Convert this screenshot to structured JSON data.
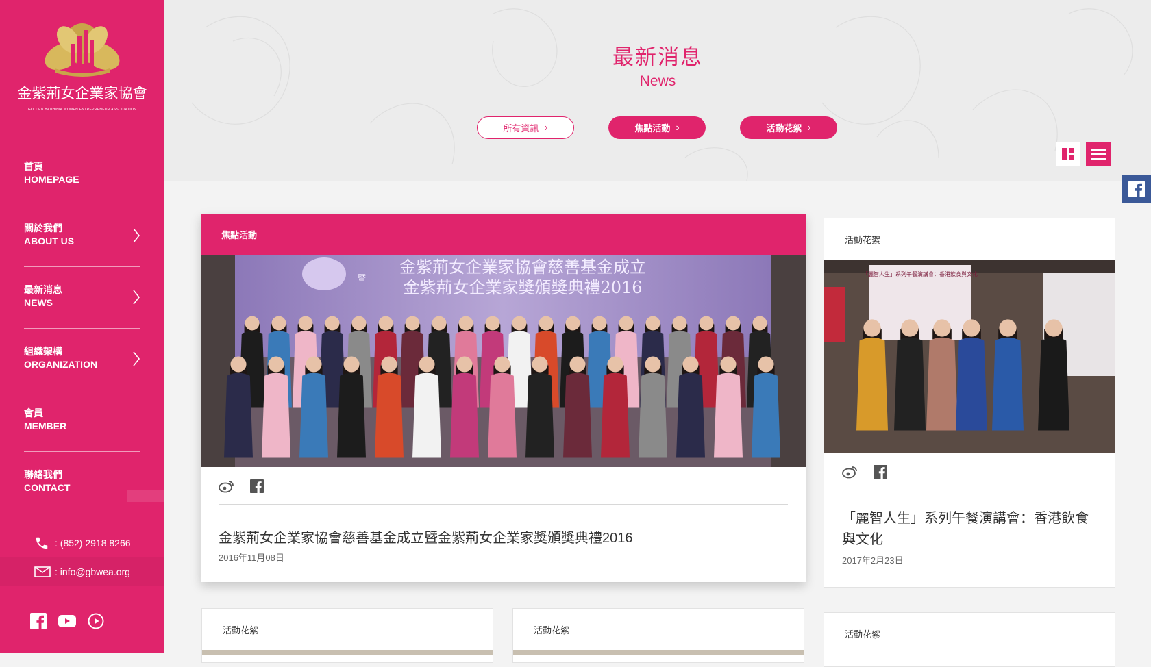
{
  "brand": {
    "name_cn": "金紫荊女企業家協會",
    "name_en": "GOLDEN BAUHINIA WOMEN ENTREPRENEUR ASSOCIATION",
    "primary": "#e0246c",
    "gold": "#c9a44a"
  },
  "nav": [
    {
      "cn": "首頁",
      "en": "HOMEPAGE",
      "submenu": false
    },
    {
      "cn": "關於我們",
      "en": "ABOUT US",
      "submenu": true
    },
    {
      "cn": "最新消息",
      "en": "NEWS",
      "submenu": true
    },
    {
      "cn": "組織架構",
      "en": "ORGANIZATION",
      "submenu": true
    },
    {
      "cn": "會員",
      "en": "MEMBER",
      "submenu": false
    },
    {
      "cn": "聯絡我們",
      "en": "CONTACT",
      "submenu": false
    }
  ],
  "contact": {
    "phone": ": (852) 2918 8266",
    "email": ": info@gbwea.org"
  },
  "social_icons": [
    "facebook-icon",
    "youtube-icon",
    "play-icon"
  ],
  "header": {
    "title_cn": "最新消息",
    "title_en": "News"
  },
  "filters": [
    {
      "label": "所有資訊",
      "active": false
    },
    {
      "label": "焦點活動",
      "active": true
    },
    {
      "label": "活動花絮",
      "active": true
    }
  ],
  "view_modes": [
    "grid-view-icon",
    "list-view-icon"
  ],
  "cards": {
    "featured": {
      "category": "焦點活動",
      "image_banner_line1": "金紫荊女企業家協會慈善基金成立",
      "image_banner_mid": "暨",
      "image_banner_line2": "金紫荊女企業家獎頒獎典禮2016",
      "title": "金紫荊女企業家協會慈善基金成立暨金紫荊女企業家獎頒獎典禮2016",
      "date": "2016年11月08日"
    },
    "side": {
      "category": "活動花絮",
      "image_poster_title": "「麗智人生」系列午餐演講會：香港飲食與文化",
      "title": "「麗智人生」系列午餐演講會：香港飲食與文化",
      "date": "2017年2月23日"
    },
    "bottom": [
      {
        "category": "活動花絮"
      },
      {
        "category": "活動花絮"
      },
      {
        "category": "活動花絮"
      }
    ]
  }
}
